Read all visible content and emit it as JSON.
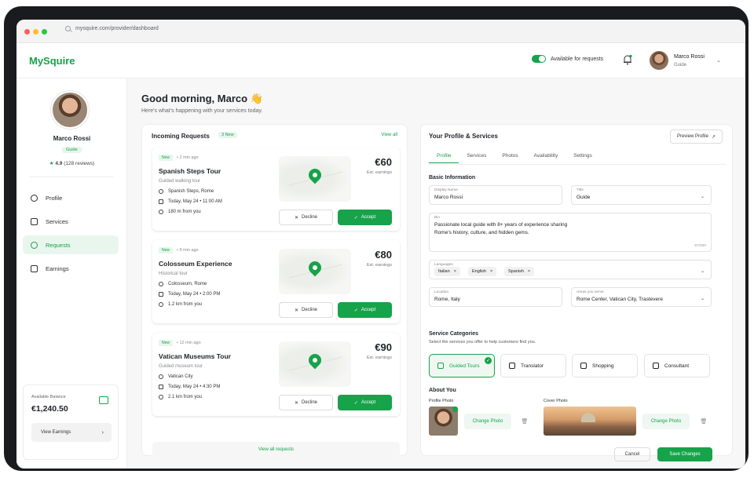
{
  "browser": {
    "url": "mysquire.com/provider/dashboard"
  },
  "brand": {
    "name": "MySquire",
    "accent": "#16a34a"
  },
  "topbar": {
    "availability_label": "Available for requests",
    "user_name": "Marco Rossi",
    "user_role": "Guide"
  },
  "sidebar": {
    "name": "Marco Rossi",
    "badge": "Guide",
    "rating": "4.9",
    "reviews": "(128 reviews)",
    "nav": [
      {
        "label": "Profile",
        "icon": "user-icon"
      },
      {
        "label": "Services",
        "icon": "briefcase-icon"
      },
      {
        "label": "Requests",
        "icon": "chat-icon"
      },
      {
        "label": "Earnings",
        "icon": "bar-chart-icon"
      }
    ],
    "balance": {
      "label": "Available Balance",
      "value": "€1,240.50",
      "button": "View Earnings"
    }
  },
  "greeting": {
    "title": "Good morning, Marco 👋",
    "subtitle": "Here's what's happening with your services today."
  },
  "requests": {
    "title": "Incoming Requests",
    "new_count": "3 New",
    "view_all": "View all",
    "earnings_label": "Est. earnings",
    "decline": "Decline",
    "accept": "Accept",
    "new_tag": "New",
    "items": [
      {
        "time": "• 2 min ago",
        "title": "Spanish Steps Tour",
        "type": "Guided walking tour",
        "place": "Spanish Steps, Rome",
        "when": "Today, May 24  •  11:00 AM",
        "distance": "180 m from you",
        "price": "€60"
      },
      {
        "time": "• 5 min ago",
        "title": "Colosseum Experience",
        "type": "Historical tour",
        "place": "Colosseum, Rome",
        "when": "Today, May 24  •  2:00 PM",
        "distance": "1.2 km from you",
        "price": "€80"
      },
      {
        "time": "• 12 min ago",
        "title": "Vatican Museums Tour",
        "type": "Guided museum tour",
        "place": "Vatican City",
        "when": "Today, May 24  •  4:30 PM",
        "distance": "2.1 km from you",
        "price": "€90"
      }
    ],
    "view_all_requests": "View all requests"
  },
  "profile": {
    "title": "Your Profile & Services",
    "preview": "Preview Profile",
    "tabs": [
      "Profile",
      "Services",
      "Photos",
      "Availability",
      "Settings"
    ],
    "basic_info": "Basic Information",
    "display_name_label": "Display Name",
    "display_name": "Marco Rossi",
    "title_label": "Title",
    "title_value": "Guide",
    "bio_label": "Bio",
    "bio_line1": "Passionate local guide with 8+ years of experience sharing",
    "bio_line2": "Rome's history, culture, and hidden gems.",
    "bio_count": "87/250",
    "languages_label": "Languages",
    "languages": [
      "Italian",
      "English",
      "Spanish"
    ],
    "location_label": "Location",
    "location": "Rome, Italy",
    "areas_label": "Areas you serve",
    "areas": "Rome Center, Vatican City, Trastevere",
    "categories_title": "Service Categories",
    "categories_sub": "Select the services you offer to help customers find you.",
    "categories": [
      "Guided Tours",
      "Translator",
      "Shopping",
      "Consultant"
    ],
    "about_title": "About You",
    "profile_photo_label": "Profile Photo",
    "cover_photo_label": "Cover Photo",
    "change_photo": "Change Photo",
    "cancel": "Cancel",
    "save": "Save Changes"
  }
}
